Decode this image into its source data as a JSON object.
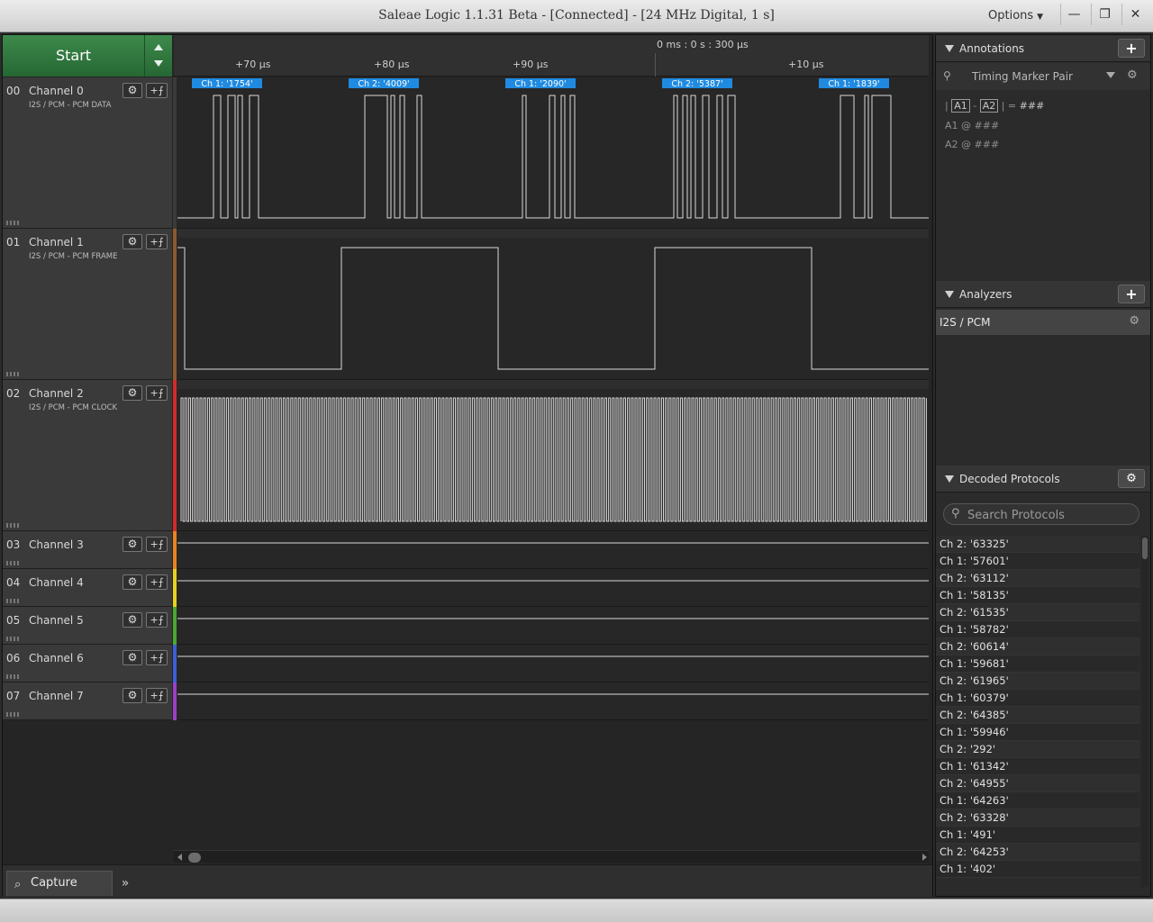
{
  "window": {
    "title": "Saleae Logic 1.1.31 Beta - [Connected] - [24 MHz Digital, 1 s]",
    "options_label": "Options"
  },
  "toolbar": {
    "start_label": "Start"
  },
  "ruler": {
    "absolute_time": "0 ms : 0 s : 300 μs",
    "ticks": [
      "+70 μs",
      "+80 μs",
      "+90 μs",
      "+10 μs"
    ]
  },
  "decoded_bubbles": [
    "Ch 1: '1754'",
    "Ch 2: '4009'",
    "Ch 1: '2090'",
    "Ch 2: '5387'",
    "Ch 1: '1839'"
  ],
  "channels": [
    {
      "num": "00",
      "name": "Channel 0",
      "sub": "I2S / PCM - PCM DATA",
      "color": "#3a3a3a"
    },
    {
      "num": "01",
      "name": "Channel 1",
      "sub": "I2S / PCM - PCM FRAME",
      "color": "#8b5a2b"
    },
    {
      "num": "02",
      "name": "Channel 2",
      "sub": "I2S / PCM - PCM CLOCK",
      "color": "#d42a2a"
    },
    {
      "num": "03",
      "name": "Channel 3",
      "sub": "",
      "color": "#e8831f"
    },
    {
      "num": "04",
      "name": "Channel 4",
      "sub": "",
      "color": "#e6d21e"
    },
    {
      "num": "05",
      "name": "Channel 5",
      "sub": "",
      "color": "#4aa832"
    },
    {
      "num": "06",
      "name": "Channel 6",
      "sub": "",
      "color": "#3b5fd6"
    },
    {
      "num": "07",
      "name": "Channel 7",
      "sub": "",
      "color": "#9a3fc7"
    }
  ],
  "bottom": {
    "capture_tab": "Capture"
  },
  "annotations": {
    "header": "Annotations",
    "marker_pair": "Timing Marker Pair",
    "a1": "A1",
    "a2": "A2",
    "diff_value": "###",
    "a1_value": "###",
    "a2_value": "###"
  },
  "analyzers": {
    "header": "Analyzers",
    "items": [
      "I2S / PCM"
    ]
  },
  "decoded": {
    "header": "Decoded Protocols",
    "search_placeholder": "Search Protocols",
    "items": [
      "Ch 2: '63325'",
      "Ch 1: '57601'",
      "Ch 2: '63112'",
      "Ch 1: '58135'",
      "Ch 2: '61535'",
      "Ch 1: '58782'",
      "Ch 2: '60614'",
      "Ch 1: '59681'",
      "Ch 2: '61965'",
      "Ch 1: '60379'",
      "Ch 2: '64385'",
      "Ch 1: '59946'",
      "Ch 2: '292'",
      "Ch 1: '61342'",
      "Ch 2: '64955'",
      "Ch 1: '64263'",
      "Ch 2: '63328'",
      "Ch 1: '491'",
      "Ch 2: '64253'",
      "Ch 1: '402'"
    ]
  }
}
